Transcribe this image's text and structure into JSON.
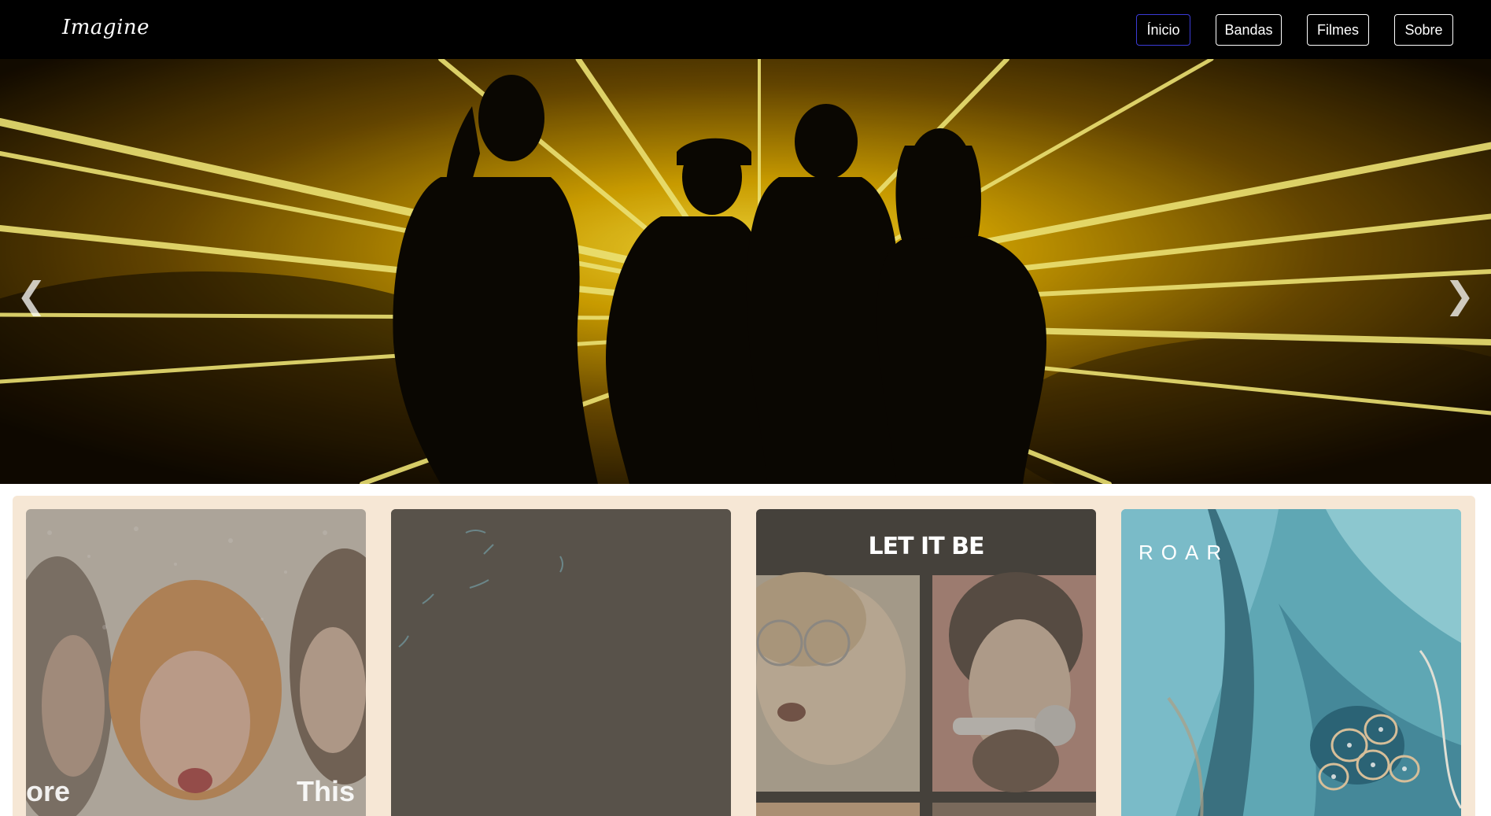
{
  "brand": {
    "logo_text": "Imagine"
  },
  "nav": {
    "items": [
      {
        "label": "Ínicio",
        "active": true
      },
      {
        "label": "Bandas",
        "active": false
      },
      {
        "label": "Filmes",
        "active": false
      },
      {
        "label": "Sobre",
        "active": false
      }
    ]
  },
  "hero": {
    "prev_arrow": "❮",
    "next_arrow": "❯"
  },
  "albums": [
    {
      "text_left": "ore",
      "text_right": "This"
    },
    {},
    {
      "title": "LET IT BE"
    },
    {
      "title": "ROAR"
    }
  ],
  "colors": {
    "navbar": "#000000",
    "active_border": "#3b3bd6",
    "strip_background": "#f6e7d5"
  }
}
